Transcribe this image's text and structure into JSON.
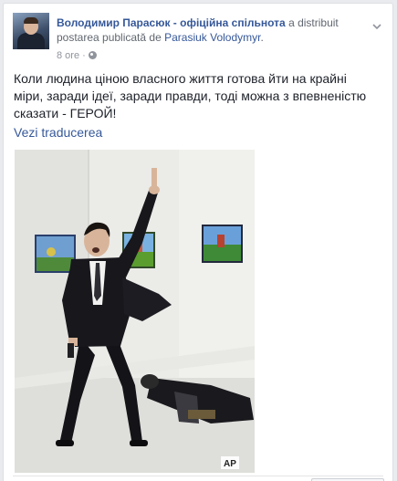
{
  "post": {
    "page_name": "Володимир Парасюк - офіційна спільнота",
    "shared_by_text": " a distribuit postarea publicată de ",
    "original_author": "Parasiuk Volodymyr",
    "period": ".",
    "time": "8 ore",
    "dot": "·",
    "privacy_icon": "globe-icon",
    "menu_icon": "chevron-down-icon",
    "body": "Коли людина ціною власного життя готова йти на крайні міри, заради ідеї, заради правди, тоді можна з впевненістю сказати - ГЕРОЙ!",
    "see_translation": "Vezi traducerea",
    "photo": {
      "watermark": "AP",
      "description_icon": "photo-icon"
    }
  },
  "colors": {
    "link": "#365899",
    "meta": "#90949c",
    "text": "#1d2129",
    "background": "#e9ebee"
  }
}
